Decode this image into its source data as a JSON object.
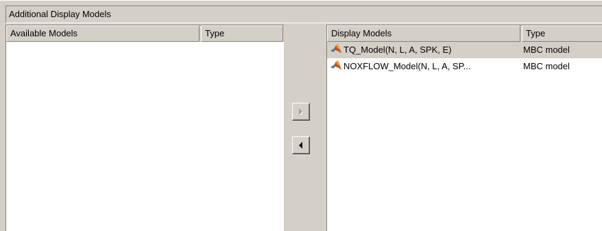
{
  "group": {
    "title": "Additional Display Models"
  },
  "available_models": {
    "columns": [
      "Available Models",
      "Type"
    ],
    "rows": []
  },
  "display_models": {
    "columns": [
      "Display Models",
      "Type"
    ],
    "rows": [
      {
        "icon": "matlab-icon",
        "name": "TQ_Model(N, L, A, SPK, E)",
        "type": "MBC model",
        "selected": true
      },
      {
        "icon": "matlab-icon",
        "name": "NOXFLOW_Model(N, L, A, SP...",
        "type": "MBC model",
        "selected": false
      }
    ]
  },
  "buttons": {
    "add": {
      "icon": "arrow-right-icon",
      "enabled": false
    },
    "remove": {
      "icon": "arrow-left-icon",
      "enabled": true
    }
  },
  "colors": {
    "background": "#d4d0c8",
    "list_background": "#ffffff",
    "selected_row": "#d4d0c8"
  }
}
